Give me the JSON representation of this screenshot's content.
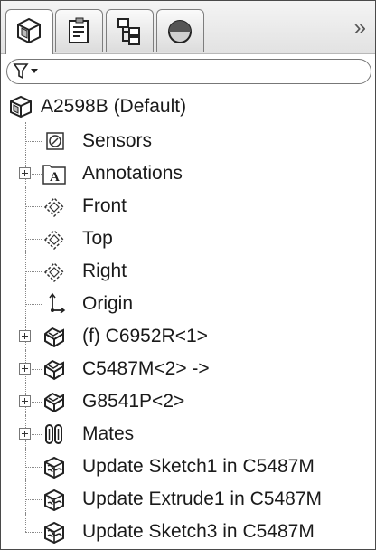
{
  "tabs": [
    {
      "name": "feature-manager-tab",
      "icon": "assembly-icon",
      "active": true
    },
    {
      "name": "property-manager-tab",
      "icon": "property-icon",
      "active": false
    },
    {
      "name": "configuration-manager-tab",
      "icon": "configuration-icon",
      "active": false
    },
    {
      "name": "display-manager-tab",
      "icon": "appearance-icon",
      "active": false
    }
  ],
  "overflow_glyph": "»",
  "filter": {
    "icon": "filter-icon",
    "value": ""
  },
  "tree": {
    "root": {
      "label": "A2598B  (Default)",
      "icon": "assembly-icon"
    },
    "items": [
      {
        "label": "Sensors",
        "icon": "sensor-icon",
        "expandable": false
      },
      {
        "label": "Annotations",
        "icon": "annotation-icon",
        "expandable": true
      },
      {
        "label": "Front",
        "icon": "plane-icon",
        "expandable": false
      },
      {
        "label": "Top",
        "icon": "plane-icon",
        "expandable": false
      },
      {
        "label": "Right",
        "icon": "plane-icon",
        "expandable": false
      },
      {
        "label": "Origin",
        "icon": "origin-icon",
        "expandable": false
      },
      {
        "label": "(f) C6952R<1>",
        "icon": "part-icon",
        "expandable": true
      },
      {
        "label": "C5487M<2> ->",
        "icon": "part-icon",
        "expandable": true
      },
      {
        "label": "G8541P<2>",
        "icon": "part-icon",
        "expandable": true
      },
      {
        "label": "Mates",
        "icon": "mates-icon",
        "expandable": true
      },
      {
        "label": "Update Sketch1 in C5487M",
        "icon": "update-icon",
        "expandable": false
      },
      {
        "label": "Update Extrude1 in C5487M",
        "icon": "update-icon",
        "expandable": false
      },
      {
        "label": "Update Sketch3 in C5487M",
        "icon": "update-icon",
        "expandable": false
      }
    ]
  }
}
